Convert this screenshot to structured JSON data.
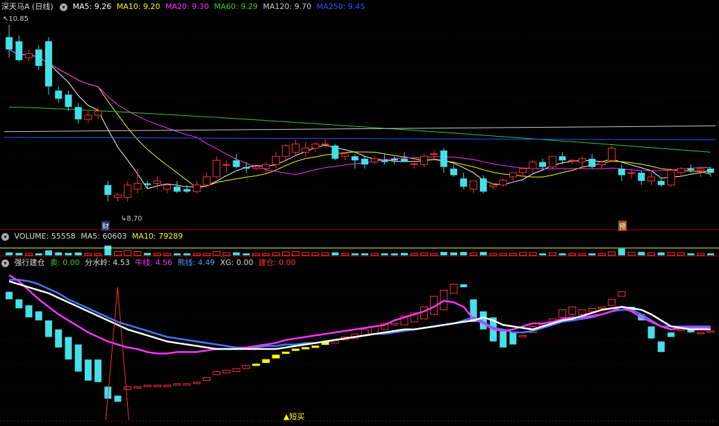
{
  "main_header": {
    "title": "深天马A (日线)",
    "items": [
      {
        "label": "MA5: 9.26",
        "color": "#ffffff"
      },
      {
        "label": "MA10: 9.20",
        "color": "#ffff00"
      },
      {
        "label": "MA20: 9.30",
        "color": "#ff33ff"
      },
      {
        "label": "MA60: 9.29",
        "color": "#33cc33"
      },
      {
        "label": "MA120: 9.70",
        "color": "#cccccc"
      },
      {
        "label": "MA250: 9.45",
        "color": "#3355ff"
      }
    ]
  },
  "vol_header": {
    "items": [
      {
        "label": "VOLUME: 55558",
        "color": "#dddddd"
      },
      {
        "label": "MA5: 60603",
        "color": "#dddddd"
      },
      {
        "label": "MA10: 79289",
        "color": "#ffff00"
      }
    ]
  },
  "ind_header": {
    "items": [
      {
        "label": "强行建仓",
        "color": "#dddddd"
      },
      {
        "label": "卖: 0.00",
        "color": "#33cc33"
      },
      {
        "label": "分水岭: 4.53",
        "color": "#dddddd"
      },
      {
        "label": "牛线: 4.56",
        "color": "#ff33ff"
      },
      {
        "label": "熊线: 4.49",
        "color": "#5599ff"
      },
      {
        "label": "XG: 0.00",
        "color": "#dddddd"
      },
      {
        "label": "建仓: 0.00",
        "color": "#ff3333"
      }
    ]
  },
  "annotations": {
    "high": "10.85",
    "low": "8.70",
    "cai": "财",
    "yu": "预",
    "buy": "▲短买"
  },
  "chart_data": {
    "type": "candlestick",
    "price_ylim": [
      8.45,
      11.0
    ],
    "candles": [
      [
        10.7,
        10.85,
        10.45,
        10.55
      ],
      [
        10.65,
        10.72,
        10.4,
        10.42
      ],
      [
        10.45,
        10.55,
        10.4,
        10.5
      ],
      [
        10.55,
        10.6,
        10.3,
        10.35
      ],
      [
        10.65,
        10.7,
        10.0,
        10.1
      ],
      [
        10.05,
        10.1,
        9.9,
        9.95
      ],
      [
        10.0,
        10.05,
        9.8,
        9.85
      ],
      [
        9.85,
        9.9,
        9.65,
        9.7
      ],
      [
        9.7,
        9.8,
        9.65,
        9.75
      ],
      [
        9.75,
        9.85,
        9.7,
        9.8
      ],
      [
        8.9,
        8.95,
        8.7,
        8.78
      ],
      [
        8.75,
        8.8,
        8.7,
        8.78
      ],
      [
        8.75,
        8.95,
        8.7,
        8.9
      ],
      [
        8.85,
        9.1,
        8.8,
        8.92
      ],
      [
        8.92,
        8.95,
        8.85,
        8.9
      ],
      [
        8.92,
        9.0,
        8.85,
        8.95
      ],
      [
        8.85,
        8.92,
        8.8,
        8.9
      ],
      [
        8.88,
        8.95,
        8.8,
        8.82
      ],
      [
        8.85,
        8.9,
        8.8,
        8.82
      ],
      [
        8.82,
        8.95,
        8.8,
        8.9
      ],
      [
        8.9,
        9.05,
        8.88,
        9.0
      ],
      [
        9.0,
        9.25,
        8.98,
        9.2
      ],
      [
        9.15,
        9.2,
        9.05,
        9.15
      ],
      [
        9.2,
        9.28,
        9.1,
        9.12
      ],
      [
        9.12,
        9.18,
        9.05,
        9.1
      ],
      [
        9.1,
        9.15,
        9.08,
        9.12
      ],
      [
        9.1,
        9.18,
        9.05,
        9.15
      ],
      [
        9.15,
        9.3,
        9.1,
        9.25
      ],
      [
        9.25,
        9.4,
        9.2,
        9.38
      ],
      [
        9.3,
        9.45,
        9.25,
        9.4
      ],
      [
        9.3,
        9.42,
        9.25,
        9.35
      ],
      [
        9.35,
        9.42,
        9.3,
        9.4
      ],
      [
        9.4,
        9.45,
        9.35,
        9.4
      ],
      [
        9.38,
        9.4,
        9.2,
        9.22
      ],
      [
        9.25,
        9.3,
        9.2,
        9.28
      ],
      [
        9.25,
        9.28,
        9.1,
        9.2
      ],
      [
        9.22,
        9.25,
        9.1,
        9.15
      ],
      [
        9.18,
        9.25,
        9.15,
        9.22
      ],
      [
        9.2,
        9.28,
        9.15,
        9.18
      ],
      [
        9.22,
        9.25,
        9.15,
        9.2
      ],
      [
        9.22,
        9.3,
        9.18,
        9.18
      ],
      [
        9.15,
        9.2,
        9.1,
        9.16
      ],
      [
        9.15,
        9.28,
        9.12,
        9.25
      ],
      [
        9.28,
        9.32,
        9.2,
        9.28
      ],
      [
        9.32,
        9.35,
        9.05,
        9.12
      ],
      [
        9.1,
        9.15,
        9.0,
        9.02
      ],
      [
        8.98,
        9.05,
        8.85,
        8.88
      ],
      [
        8.85,
        8.95,
        8.8,
        8.95
      ],
      [
        8.98,
        9.02,
        8.8,
        8.82
      ],
      [
        8.88,
        8.92,
        8.85,
        8.9
      ],
      [
        8.9,
        8.98,
        8.88,
        8.96
      ],
      [
        9.0,
        9.05,
        8.95,
        9.05
      ],
      [
        9.05,
        9.12,
        9.0,
        9.1
      ],
      [
        9.1,
        9.2,
        9.05,
        9.18
      ],
      [
        9.18,
        9.22,
        9.08,
        9.12
      ],
      [
        9.12,
        9.25,
        9.1,
        9.25
      ],
      [
        9.25,
        9.3,
        9.15,
        9.2
      ],
      [
        9.2,
        9.22,
        9.15,
        9.2
      ],
      [
        9.18,
        9.25,
        9.12,
        9.22
      ],
      [
        9.22,
        9.28,
        9.1,
        9.12
      ],
      [
        9.15,
        9.2,
        9.1,
        9.18
      ],
      [
        9.2,
        9.38,
        9.18,
        9.35
      ],
      [
        9.1,
        9.15,
        8.95,
        9.02
      ],
      [
        9.05,
        9.1,
        8.98,
        9.05
      ],
      [
        9.05,
        9.08,
        8.9,
        8.95
      ],
      [
        8.95,
        9.05,
        8.9,
        9.0
      ],
      [
        8.95,
        8.98,
        8.88,
        8.9
      ],
      [
        8.9,
        9.1,
        8.88,
        9.08
      ],
      [
        9.05,
        9.12,
        9.0,
        9.1
      ],
      [
        9.1,
        9.15,
        9.05,
        9.08
      ],
      [
        9.08,
        9.12,
        9.0,
        9.1
      ],
      [
        9.1,
        9.12,
        9.0,
        9.05
      ]
    ],
    "volume": [
      0.3,
      0.25,
      0.2,
      0.2,
      0.5,
      0.3,
      0.25,
      0.3,
      0.2,
      0.2,
      1.0,
      0.4,
      0.5,
      0.4,
      0.25,
      0.2,
      0.2,
      0.2,
      0.2,
      0.2,
      0.2,
      0.4,
      0.25,
      0.3,
      0.2,
      0.2,
      0.2,
      0.25,
      0.35,
      0.4,
      0.3,
      0.25,
      0.25,
      0.3,
      0.2,
      0.2,
      0.2,
      0.2,
      0.2,
      0.2,
      0.25,
      0.2,
      0.25,
      0.2,
      0.35,
      0.3,
      0.35,
      0.25,
      0.35,
      0.2,
      0.2,
      0.2,
      0.3,
      0.3,
      0.2,
      0.25,
      0.2,
      0.2,
      0.2,
      0.2,
      0.2,
      0.35,
      0.7,
      0.3,
      0.35,
      0.25,
      0.3,
      0.3,
      0.25,
      0.2,
      0.2,
      0.2
    ],
    "ind_bars": [
      [
        85,
        80
      ],
      [
        80,
        74
      ],
      [
        76,
        68
      ],
      [
        72,
        66
      ],
      [
        66,
        55
      ],
      [
        60,
        48
      ],
      [
        55,
        40
      ],
      [
        50,
        32
      ],
      [
        40,
        26
      ],
      [
        40,
        25
      ],
      [
        22,
        14
      ],
      [
        16,
        12
      ],
      [
        20,
        22
      ],
      [
        21,
        22
      ],
      [
        22,
        23
      ],
      [
        22,
        23
      ],
      [
        22,
        23
      ],
      [
        23,
        24
      ],
      [
        23,
        24
      ],
      [
        24,
        25
      ],
      [
        26,
        28
      ],
      [
        30,
        32
      ],
      [
        31,
        33
      ],
      [
        32,
        34
      ],
      [
        34,
        36
      ],
      [
        36,
        37
      ],
      [
        38,
        40
      ],
      [
        41,
        43
      ],
      [
        44,
        45
      ],
      [
        46,
        47
      ],
      [
        47,
        48
      ],
      [
        48,
        49
      ],
      [
        50,
        52
      ],
      [
        51,
        53
      ],
      [
        53,
        55
      ],
      [
        54,
        57
      ],
      [
        56,
        60
      ],
      [
        57,
        62
      ],
      [
        60,
        64
      ],
      [
        63,
        64
      ],
      [
        63,
        69
      ],
      [
        65,
        71
      ],
      [
        67,
        75
      ],
      [
        70,
        82
      ],
      [
        73,
        86
      ],
      [
        84,
        90
      ],
      [
        90,
        88
      ],
      [
        80,
        65
      ],
      [
        72,
        60
      ],
      [
        68,
        52
      ],
      [
        60,
        48
      ],
      [
        58,
        50
      ],
      [
        55,
        56
      ],
      [
        58,
        62
      ],
      [
        62,
        63
      ],
      [
        64,
        67
      ],
      [
        68,
        73
      ],
      [
        70,
        75
      ],
      [
        70,
        73
      ],
      [
        72,
        74
      ],
      [
        74,
        75
      ],
      [
        76,
        80
      ],
      [
        82,
        85
      ],
      [
        75,
        72
      ],
      [
        70,
        66
      ],
      [
        62,
        54
      ],
      [
        52,
        45
      ],
      [
        58,
        55
      ],
      [
        60,
        60
      ],
      [
        60,
        58
      ],
      [
        58,
        58
      ],
      [
        59,
        59
      ]
    ],
    "lines": {
      "fen": [
        92,
        90,
        88,
        86,
        84,
        81,
        78,
        75,
        72,
        69,
        66,
        63,
        60,
        58,
        56,
        54,
        52,
        51,
        50,
        49,
        48,
        47,
        47,
        47,
        47,
        47,
        47,
        47,
        48,
        49,
        50,
        51,
        52,
        53,
        54,
        55,
        56,
        57,
        58,
        59,
        60,
        60,
        61,
        62,
        63,
        64,
        65,
        66,
        68,
        66,
        63,
        62,
        61,
        60,
        62,
        64,
        66,
        67,
        69,
        71,
        73,
        74,
        75,
        74,
        73,
        70,
        66,
        62,
        61,
        60,
        60,
        60
      ],
      "niu": [
        96,
        92,
        86,
        80,
        75,
        70,
        66,
        62,
        58,
        55,
        52,
        50,
        48,
        47,
        45,
        44,
        44,
        45,
        45,
        45,
        46,
        47,
        47,
        47,
        48,
        49,
        50,
        51,
        53,
        54,
        55,
        56,
        57,
        58,
        59,
        60,
        61,
        62,
        63,
        66,
        68,
        70,
        72,
        75,
        79,
        78,
        75,
        67,
        64,
        60,
        59,
        60,
        62,
        64,
        64,
        65,
        67,
        68,
        68,
        69,
        70,
        72,
        75,
        72,
        68,
        65,
        62,
        60,
        61,
        61,
        61,
        61
      ],
      "xiong": [
        93,
        93,
        92,
        90,
        87,
        84,
        80,
        77,
        74,
        71,
        68,
        65,
        63,
        61,
        59,
        57,
        55,
        54,
        53,
        52,
        51,
        50,
        49,
        48,
        48,
        48,
        49,
        49,
        50,
        50,
        51,
        51,
        52,
        53,
        54,
        55,
        56,
        57,
        57,
        58,
        59,
        60,
        61,
        62,
        63,
        64,
        66,
        68,
        65,
        61,
        60,
        58,
        58,
        59,
        61,
        63,
        65,
        66,
        67,
        68,
        70,
        72,
        73,
        73,
        70,
        66,
        62,
        62,
        62,
        62,
        62,
        62
      ]
    },
    "spike_index": 10,
    "buy_index": 25
  }
}
